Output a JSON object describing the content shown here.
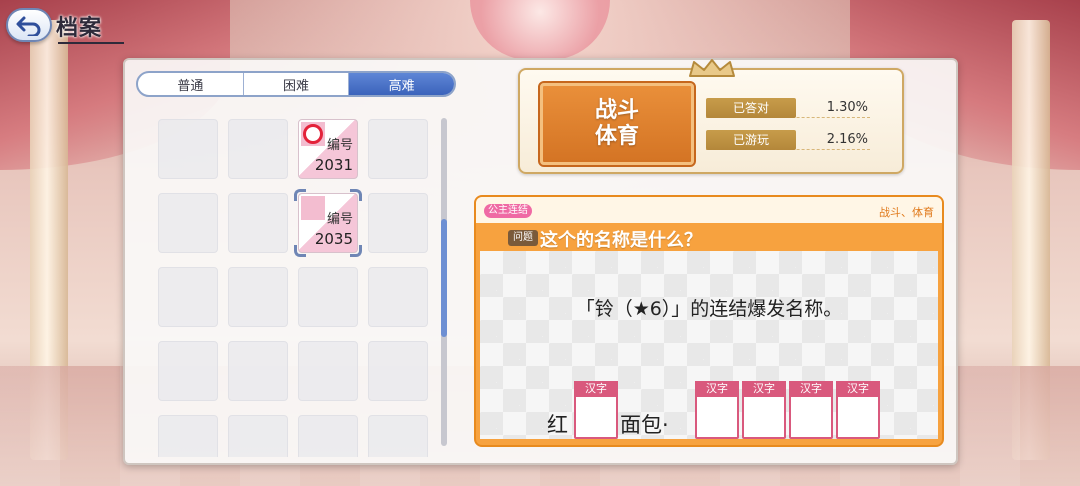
{
  "header": {
    "title": "档案"
  },
  "tabs": [
    {
      "label": "普通",
      "active": false
    },
    {
      "label": "困难",
      "active": false
    },
    {
      "label": "高难",
      "active": true
    }
  ],
  "cards": [
    {
      "label": "编号",
      "number": "2031",
      "answered": true
    },
    {
      "label": "编号",
      "number": "2035",
      "answered": false,
      "selected": true
    }
  ],
  "category": {
    "name_line1": "战斗",
    "name_line2": "体育",
    "stats": [
      {
        "label": "已答对",
        "value": "1.30%"
      },
      {
        "label": "已游玩",
        "value": "2.16%"
      }
    ]
  },
  "question": {
    "tag": "公主连结",
    "category_small": "战斗、体育",
    "q_label": "问题",
    "text": "这个的名称是什么？",
    "prompt": "「铃（★6）」的连结爆发名称。",
    "answer": {
      "fixed1": "红",
      "fixed2": "面包·",
      "hint": "汉字"
    }
  },
  "scroll": {
    "position_fraction": 0.48
  },
  "colors": {
    "accent": "#3b63bb",
    "orange": "#f7a23f",
    "pink": "#d9597d",
    "gold": "#c79c4a"
  }
}
